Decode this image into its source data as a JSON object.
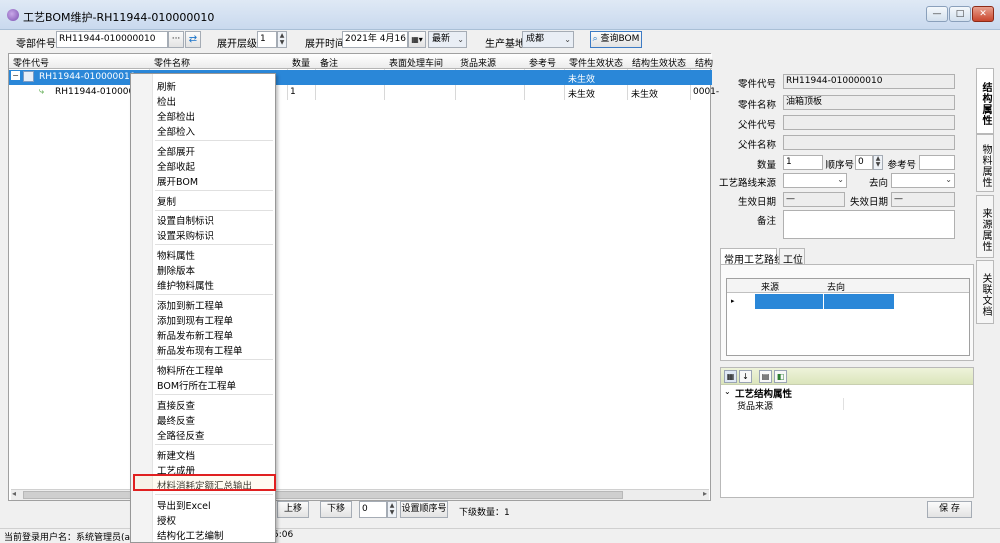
{
  "window": {
    "title": "工艺BOM维护-RH11944-010000010",
    "min": "—",
    "max": "□",
    "close": "✕"
  },
  "toolbar": {
    "part_code_label": "零部件号",
    "part_code_value": "RH11944-010000010",
    "more_btn": "···",
    "level_label": "展开层级",
    "level_value": "1",
    "time_label": "展开时间",
    "time_value": "2021年 4月16日",
    "time_mode": "最新",
    "base_label": "生产基地",
    "base_value": "成都",
    "query_btn": "查询BOM"
  },
  "grid": {
    "columns": [
      "零件代号",
      "零件名称",
      "数量",
      "备注",
      "表面处理车间",
      "货品来源",
      "参考号",
      "零件生效状态",
      "结构生效状态",
      "结构"
    ],
    "rows": [
      {
        "code": "RH11944-010000010",
        "name": "",
        "qty": "",
        "part_status": "未生效",
        "struct_status": "",
        "extra": ""
      },
      {
        "code": "RH11944-010000020",
        "name": "",
        "qty": "1",
        "part_status": "未生效",
        "struct_status": "未生效",
        "extra": "0001-"
      }
    ]
  },
  "context_menu": {
    "items": [
      "刷新",
      "检出",
      "全部检出",
      "全部检入",
      "全部展开",
      "全部收起",
      "展开BOM",
      "复制",
      "设置自制标识",
      "设置采购标识",
      "物料属性",
      "删除版本",
      "维护物料属性",
      "添加到新工程单",
      "添加到现有工程单",
      "新品发布新工程单",
      "新品发布现有工程单",
      "物料所在工程单",
      "BOM行所在工程单",
      "直接反查",
      "最终反查",
      "全路径反查",
      "新建文档",
      "工艺成册",
      "材料消耗定额汇总输出",
      "导出到Excel",
      "授权",
      "结构化工艺编制"
    ],
    "highlighted": "材料消耗定额汇总输出"
  },
  "bottom": {
    "up_btn": "上移",
    "down_btn": "下移",
    "order_value": "0",
    "set_order_btn": "设置顺序号",
    "child_count": "下级数量：1",
    "save_btn": "保 存"
  },
  "status": {
    "user_text": "当前登录用户名：系统管理员(ad",
    "time_frag": "5:06"
  },
  "right": {
    "part_code_label": "零件代号",
    "part_code_value": "RH11944-010000010",
    "part_name_label": "零件名称",
    "part_name_value": "油箱顶板",
    "parent_code_label": "父件代号",
    "parent_code_value": "",
    "parent_name_label": "父件名称",
    "parent_name_value": "",
    "qty_label": "数量",
    "qty_value": "1",
    "seq_label": "顺序号",
    "seq_value": "0",
    "ref_label": "参考号",
    "ref_value": "",
    "route_src_label": "工艺路线来源",
    "dest_label": "去向",
    "eff_date_label": "生效日期",
    "eff_date_value": "—",
    "exp_date_label": "失效日期",
    "exp_date_value": "—",
    "remark_label": "备注",
    "tabs": [
      "常用工艺路线",
      "工位"
    ],
    "route_cols": [
      "来源",
      "去向"
    ],
    "pg_section": "工艺结构属性",
    "pg_row_label": "货品来源"
  },
  "side_tabs": [
    "结构属性",
    "物料属性",
    "来源属性",
    "关联文档"
  ],
  "colors": {
    "selection": "#2a87d8",
    "highlight_border": "#e02020"
  }
}
